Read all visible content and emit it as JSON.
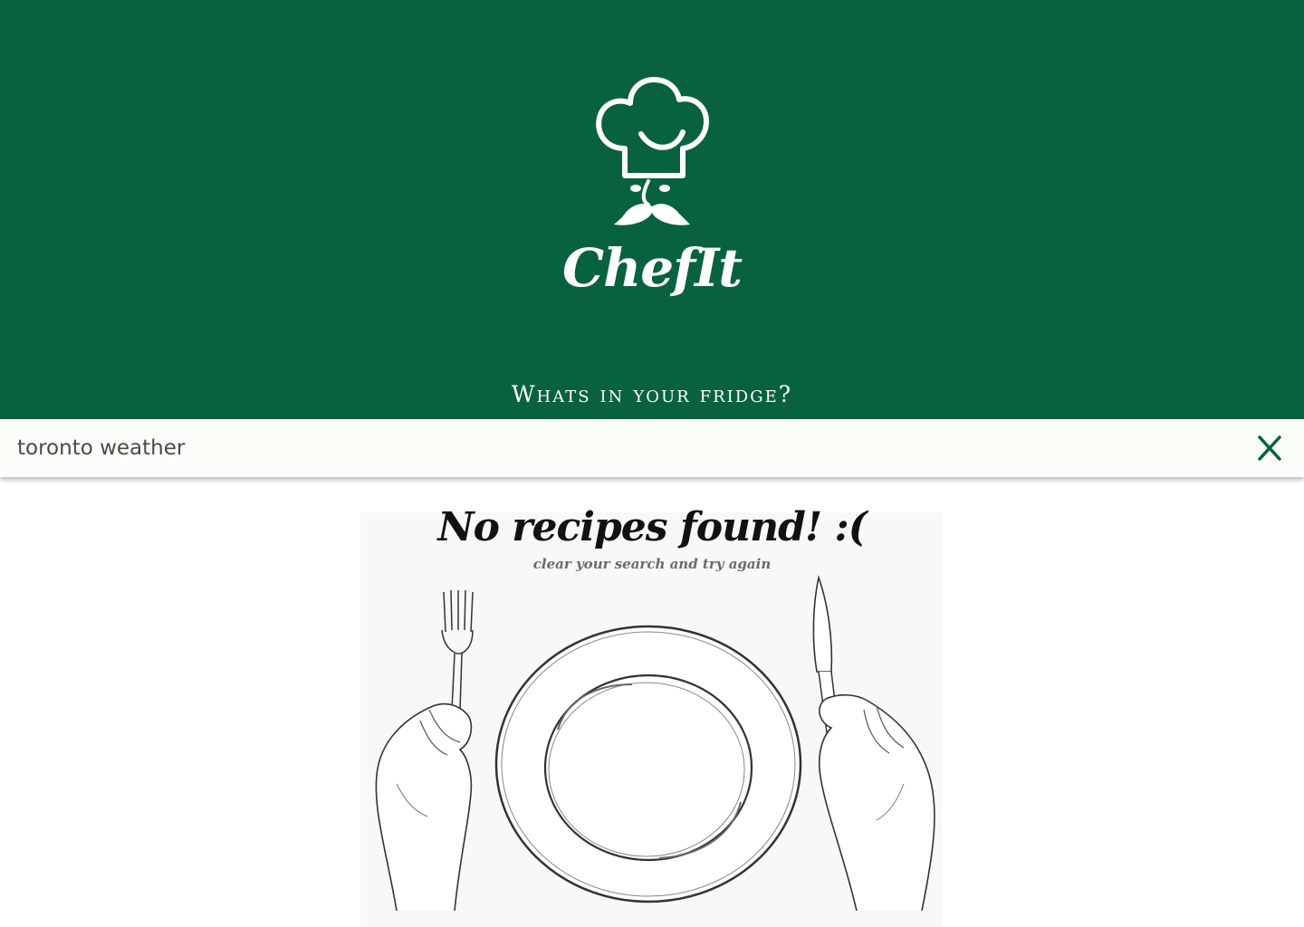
{
  "header": {
    "brand": "ChefIt",
    "tagline": "Whats in your fridge?",
    "logo_icon": "chef-hat-mustache-icon",
    "background_color": "#08623d"
  },
  "search": {
    "value": "toronto weather",
    "clear_icon": "close-icon",
    "accent_color": "#08623d"
  },
  "empty_state": {
    "title": "No recipes found! :(",
    "subtitle": "clear your search and try again",
    "illustration": "plate-fork-knife-hands-illustration"
  }
}
